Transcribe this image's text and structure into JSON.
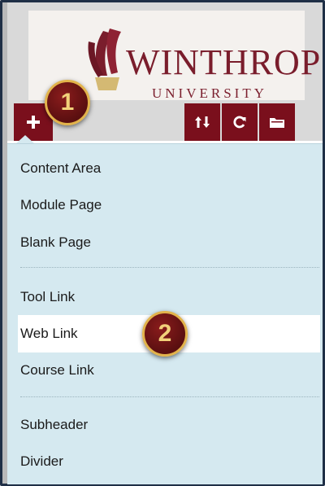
{
  "header": {
    "logo_text": "WINTHROP",
    "logo_subtitle": "UNIVERSITY"
  },
  "toolbar": {
    "add_icon": "plus-icon",
    "sort_icon": "sort-icon",
    "refresh_icon": "refresh-icon",
    "folder_icon": "folder-icon"
  },
  "menu": {
    "items": [
      {
        "label": "Content Area"
      },
      {
        "label": "Module Page"
      },
      {
        "label": "Blank Page"
      },
      {
        "label": "Tool Link"
      },
      {
        "label": "Web Link"
      },
      {
        "label": "Course Link"
      },
      {
        "label": "Subheader"
      },
      {
        "label": "Divider"
      }
    ]
  },
  "badges": {
    "one": "1",
    "two": "2"
  },
  "colors": {
    "brand_maroon": "#7a0f1c",
    "menu_bg": "#d5e9f0",
    "highlight": "#ffffff",
    "badge_ring": "#e2b34b"
  }
}
